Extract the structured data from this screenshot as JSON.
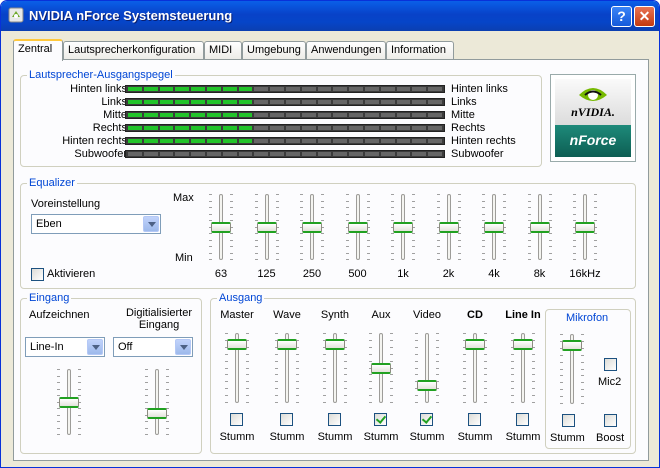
{
  "window": {
    "title": "NVIDIA nForce Systemsteuerung",
    "help_label": "?",
    "close_label": "✕"
  },
  "tabs": [
    "Zentral",
    "Lautsprecherkonfiguration",
    "MIDI",
    "Umgebung",
    "Anwendungen",
    "Information"
  ],
  "levels": {
    "title": "Lautsprecher-Ausgangspegel",
    "channels": [
      {
        "left": "Hinten links",
        "right": "Hinten links",
        "level": 0.4
      },
      {
        "left": "Links",
        "right": "Links",
        "level": 0.4
      },
      {
        "left": "Mitte",
        "right": "Mitte",
        "level": 0.4
      },
      {
        "left": "Rechts",
        "right": "Rechts",
        "level": 0.4
      },
      {
        "left": "Hinten rechts",
        "right": "Hinten rechts",
        "level": 0.4
      },
      {
        "left": "Subwoofer",
        "right": "Subwoofer",
        "level": 0.0
      }
    ]
  },
  "logo": {
    "brand": "nVIDIA.",
    "product": "nForce"
  },
  "equalizer": {
    "title": "Equalizer",
    "preset_label": "Voreinstellung",
    "preset_value": "Eben",
    "max_label": "Max",
    "min_label": "Min",
    "activate_label": "Aktivieren",
    "activated": false,
    "bands": [
      {
        "label": "63",
        "level": 0.5
      },
      {
        "label": "125",
        "level": 0.5
      },
      {
        "label": "250",
        "level": 0.5
      },
      {
        "label": "500",
        "level": 0.5
      },
      {
        "label": "1k",
        "level": 0.5
      },
      {
        "label": "2k",
        "level": 0.5
      },
      {
        "label": "4k",
        "level": 0.5
      },
      {
        "label": "8k",
        "level": 0.5
      },
      {
        "label": "16kHz",
        "level": 0.5
      }
    ]
  },
  "input": {
    "title": "Eingang",
    "record_label": "Aufzeichnen",
    "record_value": "Line-In",
    "digital_label": "Digitialisierter Eingang",
    "digital_value": "Off",
    "record_level": 0.5,
    "digital_level": 0.3
  },
  "output": {
    "title": "Ausgang",
    "mute_label": "Stumm",
    "channels": [
      {
        "label": "Master",
        "level": 0.9,
        "muted": false,
        "bold": false
      },
      {
        "label": "Wave",
        "level": 0.9,
        "muted": false,
        "bold": false
      },
      {
        "label": "Synth",
        "level": 0.9,
        "muted": false,
        "bold": false
      },
      {
        "label": "Aux",
        "level": 0.5,
        "muted": true,
        "bold": false
      },
      {
        "label": "Video",
        "level": 0.2,
        "muted": true,
        "bold": false
      },
      {
        "label": "CD",
        "level": 0.9,
        "muted": false,
        "bold": true
      },
      {
        "label": "Line In",
        "level": 0.9,
        "muted": false,
        "bold": true
      }
    ]
  },
  "mic": {
    "title": "Mikrofon",
    "level": 0.9,
    "mic2_label": "Mic2",
    "mute_label": "Stumm",
    "boost_label": "Boost",
    "mic2": false,
    "muted": false,
    "boost": false
  },
  "colors": {
    "accent": "#0046D5",
    "meter_on": "#22C42A",
    "thumb_edge": "#21A121"
  }
}
